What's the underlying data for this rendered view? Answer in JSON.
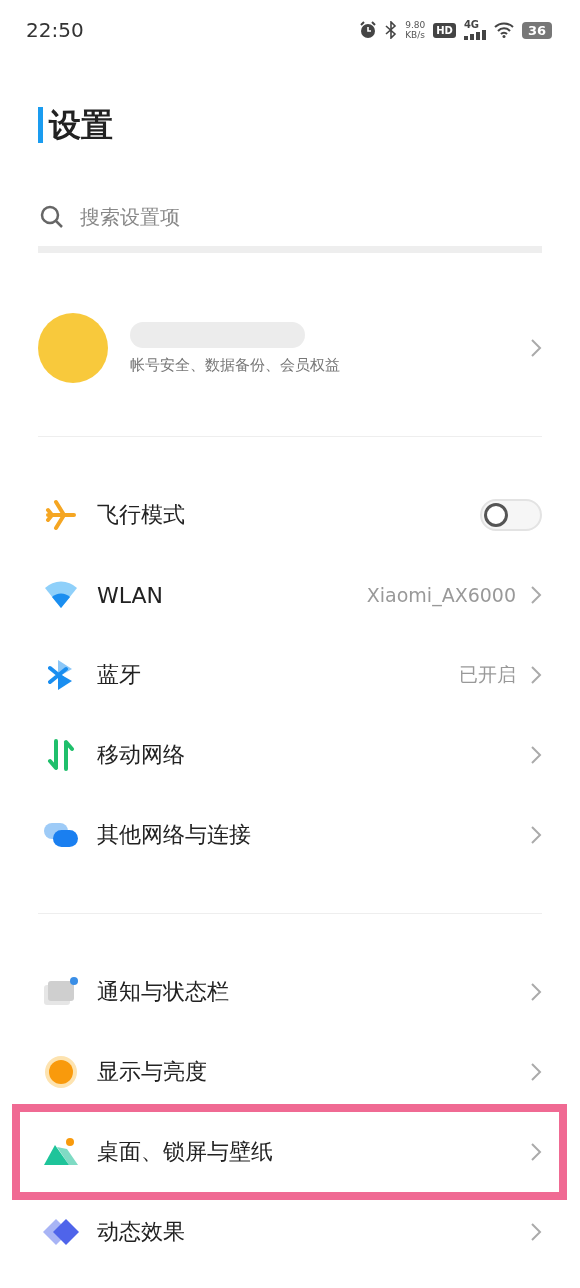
{
  "status_bar": {
    "time": "22:50",
    "speed_value": "9.80",
    "speed_unit": "KB/s",
    "hd_badge": "HD",
    "network_type": "4G",
    "battery": "36"
  },
  "title": "设置",
  "search": {
    "placeholder": "搜索设置项"
  },
  "account": {
    "subtitle": "帐号安全、数据备份、会员权益"
  },
  "groups": [
    {
      "items": [
        {
          "label": "飞行模式",
          "kind": "switch",
          "on": false,
          "highlighted": false
        },
        {
          "label": "WLAN",
          "value": "Xiaomi_AX6000",
          "kind": "link",
          "highlighted": false
        },
        {
          "label": "蓝牙",
          "value": "已开启",
          "kind": "link",
          "highlighted": false
        },
        {
          "label": "移动网络",
          "kind": "link",
          "highlighted": false
        },
        {
          "label": "其他网络与连接",
          "kind": "link",
          "highlighted": false
        }
      ]
    },
    {
      "items": [
        {
          "label": "通知与状态栏",
          "kind": "link",
          "highlighted": false
        },
        {
          "label": "显示与亮度",
          "kind": "link",
          "highlighted": false
        },
        {
          "label": "桌面、锁屏与壁纸",
          "kind": "link",
          "highlighted": true
        },
        {
          "label": "动态效果",
          "kind": "link",
          "highlighted": false
        }
      ]
    }
  ]
}
